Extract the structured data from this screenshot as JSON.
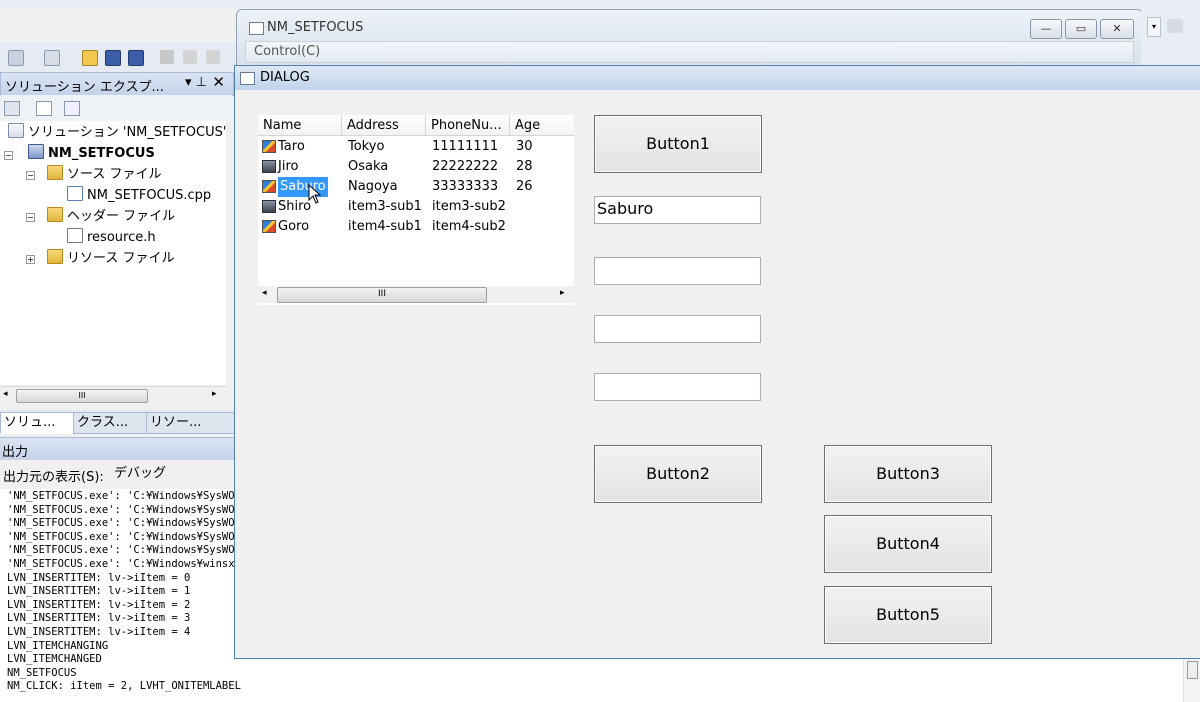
{
  "main_window": {
    "title": "NM_SETFOCUS",
    "menu_control": "Control(C)",
    "caption_buttons": [
      "minimize",
      "maximize",
      "close"
    ]
  },
  "solution_explorer": {
    "title": "ソリューション エクスプ...",
    "tree": [
      {
        "label": "ソリューション 'NM_SETFOCUS'",
        "icon": "solution-icon"
      },
      {
        "label": "NM_SETFOCUS",
        "icon": "project-icon"
      },
      {
        "label": "ソース ファイル",
        "icon": "folder-icon"
      },
      {
        "label": "NM_SETFOCUS.cpp",
        "icon": "cpp-file-icon"
      },
      {
        "label": "ヘッダー ファイル",
        "icon": "folder-icon"
      },
      {
        "label": "resource.h",
        "icon": "header-file-icon"
      },
      {
        "label": "リソース ファイル",
        "icon": "folder-icon"
      }
    ],
    "tabs": [
      "ソリュ...",
      "クラス...",
      "リソー..."
    ],
    "scroll_thumb": "III"
  },
  "output": {
    "title": "出力",
    "source_label": "出力元の表示(S):",
    "source_value": "デバッグ",
    "lines": [
      "'NM_SETFOCUS.exe': 'C:¥Windows¥SysWO",
      "'NM_SETFOCUS.exe': 'C:¥Windows¥SysWO",
      "'NM_SETFOCUS.exe': 'C:¥Windows¥SysWO",
      "'NM_SETFOCUS.exe': 'C:¥Windows¥SysWO",
      "'NM_SETFOCUS.exe': 'C:¥Windows¥SysWO",
      "'NM_SETFOCUS.exe': 'C:¥Windows¥winsx",
      "LVN_INSERTITEM: lv->iItem = 0",
      "LVN_INSERTITEM: lv->iItem = 1",
      "LVN_INSERTITEM: lv->iItem = 2",
      "LVN_INSERTITEM: lv->iItem = 3",
      "LVN_INSERTITEM: lv->iItem = 4",
      "LVN_ITEMCHANGING",
      "LVN_ITEMCHANGED",
      "NM_SETFOCUS",
      "NM_CLICK: iItem = 2, LVHT_ONITEMLABEL"
    ]
  },
  "dialog": {
    "title": "DIALOG",
    "listview": {
      "columns": [
        "Name",
        "Address",
        "PhoneNu...",
        "Age"
      ],
      "rows": [
        {
          "name": "Taro",
          "address": "Tokyo",
          "phone": "11111111",
          "age": "30",
          "icon": "edit-icon"
        },
        {
          "name": "Jiro",
          "address": "Osaka",
          "phone": "22222222",
          "age": "28",
          "icon": "computer-icon"
        },
        {
          "name": "Saburo",
          "address": "Nagoya",
          "phone": "33333333",
          "age": "26",
          "icon": "edit-icon",
          "selected": true
        },
        {
          "name": "Shiro",
          "address": "item3-sub1",
          "phone": "item3-sub2",
          "age": "",
          "icon": "computer-icon"
        },
        {
          "name": "Goro",
          "address": "item4-sub1",
          "phone": "item4-sub2",
          "age": "",
          "icon": "edit-icon"
        }
      ],
      "scroll_thumb": "III"
    },
    "buttons": {
      "button1": "Button1",
      "button2": "Button2",
      "button3": "Button3",
      "button4": "Button4",
      "button5": "Button5"
    },
    "edits": [
      "Saburo",
      "",
      "",
      ""
    ]
  }
}
